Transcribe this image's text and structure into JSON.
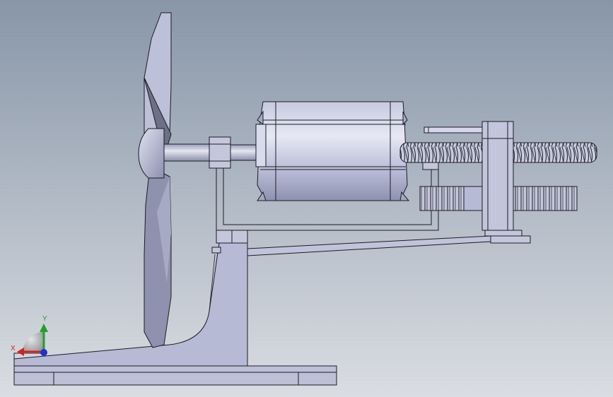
{
  "triad": {
    "x_label": "X",
    "y_label": "Y",
    "x_color": "#d42020",
    "y_color": "#1fa02a",
    "z_color": "#2030d0"
  },
  "colors": {
    "background_top": "#8896a8",
    "background_bottom": "#d9dde2",
    "part_fill": "#bcc0d8",
    "part_fill_light": "#d4d7ea",
    "part_fill_dark": "#8a8fae",
    "blade_dark": "#6a6e86",
    "edge": "#1c1c22"
  },
  "model": {
    "components": [
      "fan-blade",
      "shaft",
      "motor",
      "worm-gear",
      "spur-gear",
      "support-bracket",
      "base-plate",
      "tie-rod"
    ]
  }
}
